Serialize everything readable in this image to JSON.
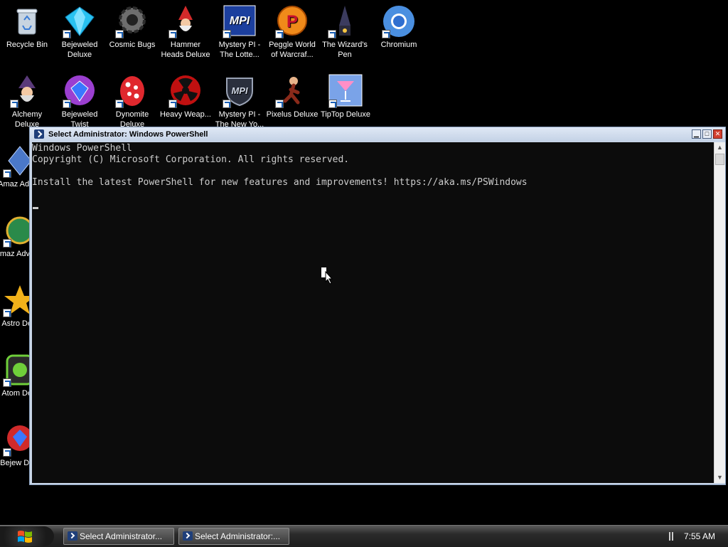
{
  "desktop": {
    "icons": [
      {
        "label": "Recycle Bin",
        "icon": "recycle-bin-icon"
      },
      {
        "label": "Bejeweled Deluxe",
        "icon": "gem-icon"
      },
      {
        "label": "Cosmic Bugs",
        "icon": "cog-bug-icon"
      },
      {
        "label": "Hammer Heads Deluxe",
        "icon": "gnome-icon"
      },
      {
        "label": "Mystery PI - The Lotte...",
        "icon": "mpi-logo-icon"
      },
      {
        "label": "Peggle World of Warcraf...",
        "icon": "peggle-icon"
      },
      {
        "label": "The Wizard's Pen",
        "icon": "wizard-hat-icon"
      },
      {
        "label": "Chromium",
        "icon": "chromium-icon"
      },
      {
        "label": "Alchemy Deluxe",
        "icon": "alchemist-icon"
      },
      {
        "label": "Bejeweled Twist",
        "icon": "gem-twist-icon"
      },
      {
        "label": "Dynomite Deluxe",
        "icon": "egg-icon"
      },
      {
        "label": "Heavy Weap...",
        "icon": "radiation-icon"
      },
      {
        "label": "Mystery PI - The New Yo...",
        "icon": "mpi-shield-icon"
      },
      {
        "label": "Pixelus Deluxe",
        "icon": "runner-icon"
      },
      {
        "label": "TipTop Deluxe",
        "icon": "cocktail-icon"
      },
      {
        "label": "Amaz Adven",
        "icon": "amazing-adventures-icon"
      },
      {
        "label": "Amaz Adventu",
        "icon": "amazing-adventures-2-icon"
      },
      {
        "label": "Astro Delu",
        "icon": "astro-star-icon"
      },
      {
        "label": "Atom Delu",
        "icon": "atom-icon"
      },
      {
        "label": "Bejew Delu",
        "icon": "bejeweled-2-icon"
      }
    ]
  },
  "window": {
    "title": "Select Administrator: Windows PowerShell",
    "buttons": {
      "minimize": "▁",
      "maximize": "□",
      "close": "✕"
    },
    "console_lines": [
      "Windows PowerShell",
      "Copyright (C) Microsoft Corporation. All rights reserved.",
      "",
      "Install the latest PowerShell for new features and improvements! https://aka.ms/PSWindows"
    ]
  },
  "taskbar": {
    "buttons": [
      {
        "label": "Select Administrator..."
      },
      {
        "label": "Select Administrator:..."
      }
    ],
    "clock": "7:55 AM"
  }
}
